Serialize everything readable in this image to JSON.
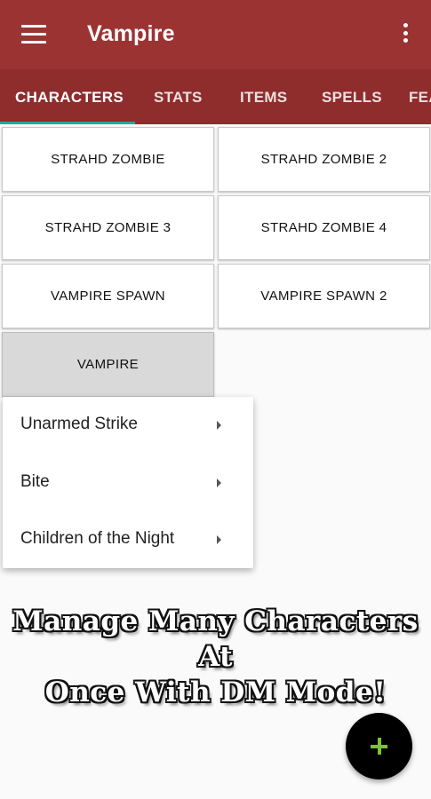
{
  "appbar": {
    "title": "Vampire",
    "menu_icon": "hamburger-icon",
    "overflow_icon": "more-vert-icon"
  },
  "tabs": [
    {
      "label": "CHARACTERS",
      "active": true
    },
    {
      "label": "STATS"
    },
    {
      "label": "ITEMS"
    },
    {
      "label": "SPELLS"
    },
    {
      "label": "FEA"
    }
  ],
  "characters": [
    "STRAHD ZOMBIE",
    "STRAHD ZOMBIE 2",
    "STRAHD ZOMBIE 3",
    "STRAHD ZOMBIE 4",
    "VAMPIRE SPAWN",
    "VAMPIRE SPAWN 2",
    "VAMPIRE"
  ],
  "popup_menu": [
    {
      "label": "Unarmed Strike",
      "icon": "submenu-arrow-icon"
    },
    {
      "label": "Bite",
      "icon": "submenu-arrow-icon"
    },
    {
      "label": "Children of the Night",
      "icon": "submenu-arrow-icon"
    }
  ],
  "promo": {
    "line1": "Manage Many Characters At",
    "line2": "Once With DM Mode!"
  },
  "colors": {
    "appbar": "#9c3333",
    "tabbar": "#8f2c2c",
    "indicator": "#26a69a",
    "fab": "#000000",
    "fab_plus": "#7cc42a"
  }
}
